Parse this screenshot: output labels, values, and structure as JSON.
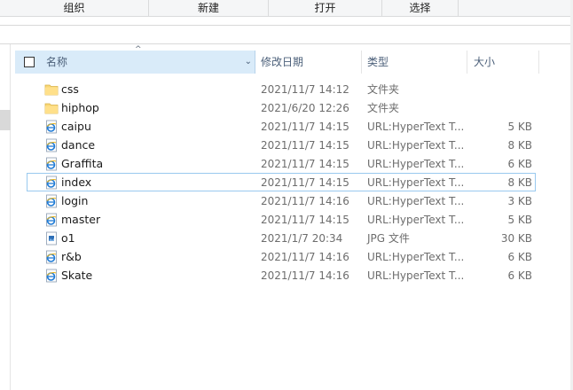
{
  "ribbon": {
    "groups": [
      "组织",
      "新建",
      "打开",
      "选择"
    ]
  },
  "columns": {
    "name": "名称",
    "date": "修改日期",
    "type": "类型",
    "size": "大小"
  },
  "files": [
    {
      "name": "css",
      "date": "2021/11/7 14:12",
      "type": "文件夹",
      "size": "",
      "icon": "folder-icon"
    },
    {
      "name": "hiphop",
      "date": "2021/6/20 12:26",
      "type": "文件夹",
      "size": "",
      "icon": "folder-icon"
    },
    {
      "name": "caipu",
      "date": "2021/11/7 14:15",
      "type": "URL:HyperText T...",
      "size": "5 KB",
      "icon": "html-file-icon"
    },
    {
      "name": "dance",
      "date": "2021/11/7 14:15",
      "type": "URL:HyperText T...",
      "size": "8 KB",
      "icon": "html-file-icon"
    },
    {
      "name": "Graffita",
      "date": "2021/11/7 14:15",
      "type": "URL:HyperText T...",
      "size": "6 KB",
      "icon": "html-file-icon"
    },
    {
      "name": "index",
      "date": "2021/11/7 14:15",
      "type": "URL:HyperText T...",
      "size": "8 KB",
      "icon": "html-file-icon",
      "focused": true
    },
    {
      "name": "login",
      "date": "2021/11/7 14:16",
      "type": "URL:HyperText T...",
      "size": "3 KB",
      "icon": "html-file-icon"
    },
    {
      "name": "master",
      "date": "2021/11/7 14:15",
      "type": "URL:HyperText T...",
      "size": "5 KB",
      "icon": "html-file-icon"
    },
    {
      "name": "o1",
      "date": "2021/1/7 20:34",
      "type": "JPG 文件",
      "size": "30 KB",
      "icon": "jpg-file-icon"
    },
    {
      "name": "r&b",
      "date": "2021/11/7 14:16",
      "type": "URL:HyperText T...",
      "size": "6 KB",
      "icon": "html-file-icon"
    },
    {
      "name": "Skate",
      "date": "2021/11/7 14:16",
      "type": "URL:HyperText T...",
      "size": "6 KB",
      "icon": "html-file-icon"
    }
  ]
}
